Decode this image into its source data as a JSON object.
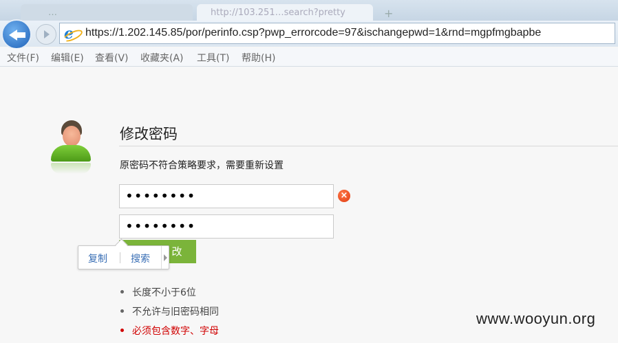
{
  "browser": {
    "tabs": [
      {
        "label": "…"
      },
      {
        "label": "http://103.251…search?pretty"
      }
    ],
    "new_tab_label": "+",
    "url": "https://1.202.145.85/por/perinfo.csp?pwp_errorcode=97&ischangepwd=1&rnd=mgpfmgbapbe"
  },
  "menu": {
    "items": [
      "文件(F)",
      "编辑(E)",
      "查看(V)",
      "收藏夹(A)",
      "工具(T)",
      "帮助(H)"
    ]
  },
  "page": {
    "title": "修改密码",
    "notice": "原密码不符合策略要求，需要重新设置",
    "password1": "••••••••",
    "password2": "••••••••",
    "error_icon": "×",
    "submit_label": "改",
    "context_menu": {
      "copy": "复制",
      "search": "搜索"
    },
    "rules": [
      {
        "text": "长度不小于6位",
        "color": "#444444"
      },
      {
        "text": "不允许与旧密码相同",
        "color": "#444444"
      },
      {
        "text": "必须包含数字、字母",
        "color": "#d00000"
      }
    ]
  },
  "watermark": "www.wooyun.org",
  "icons": {
    "back": "back-arrow-icon",
    "forward": "forward-arrow-icon",
    "browser": "ie-logo-icon",
    "error": "error-x-icon",
    "user": "user-avatar-icon"
  }
}
